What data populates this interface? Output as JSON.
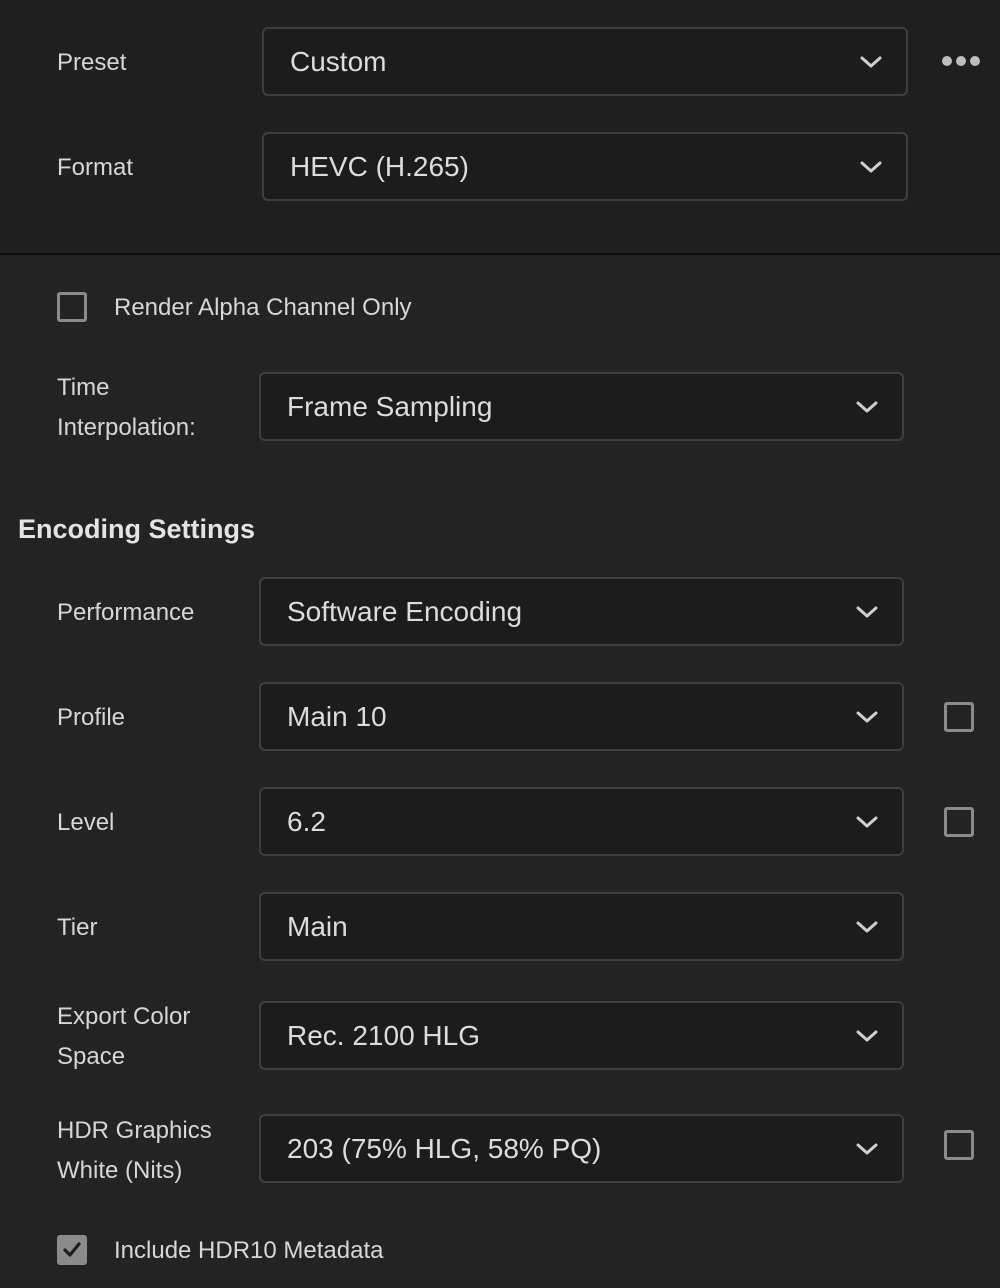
{
  "preset": {
    "label": "Preset",
    "value": "Custom"
  },
  "format": {
    "label": "Format",
    "value": "HEVC (H.265)"
  },
  "render_alpha": {
    "label": "Render Alpha Channel Only",
    "checked": false
  },
  "time_interpolation": {
    "label_line1": "Time",
    "label_line2": "Interpolation:",
    "value": "Frame Sampling"
  },
  "encoding": {
    "heading": "Encoding Settings",
    "performance": {
      "label": "Performance",
      "value": "Software Encoding"
    },
    "profile": {
      "label": "Profile",
      "value": "Main 10",
      "checkbox_checked": false
    },
    "level": {
      "label": "Level",
      "value": "6.2",
      "checkbox_checked": false
    },
    "tier": {
      "label": "Tier",
      "value": "Main"
    },
    "color_space": {
      "label_line1": "Export Color",
      "label_line2": "Space",
      "value": "Rec. 2100 HLG"
    },
    "hdr_white": {
      "label_line1": "HDR Graphics",
      "label_line2": "White (Nits)",
      "value": "203 (75% HLG, 58% PQ)",
      "checkbox_checked": false
    },
    "hdr10_metadata": {
      "label": "Include HDR10 Metadata",
      "checked": true
    }
  },
  "icons": {
    "dropdown": "chevron-down-icon",
    "more": "more-options-icon",
    "check": "checkmark-icon"
  },
  "colors": {
    "background": "#232323",
    "top_panel": "#1f1f1f",
    "field": "#1c1c1c",
    "border": "#3e3e3e",
    "checkbox": "#8b8b8b"
  }
}
